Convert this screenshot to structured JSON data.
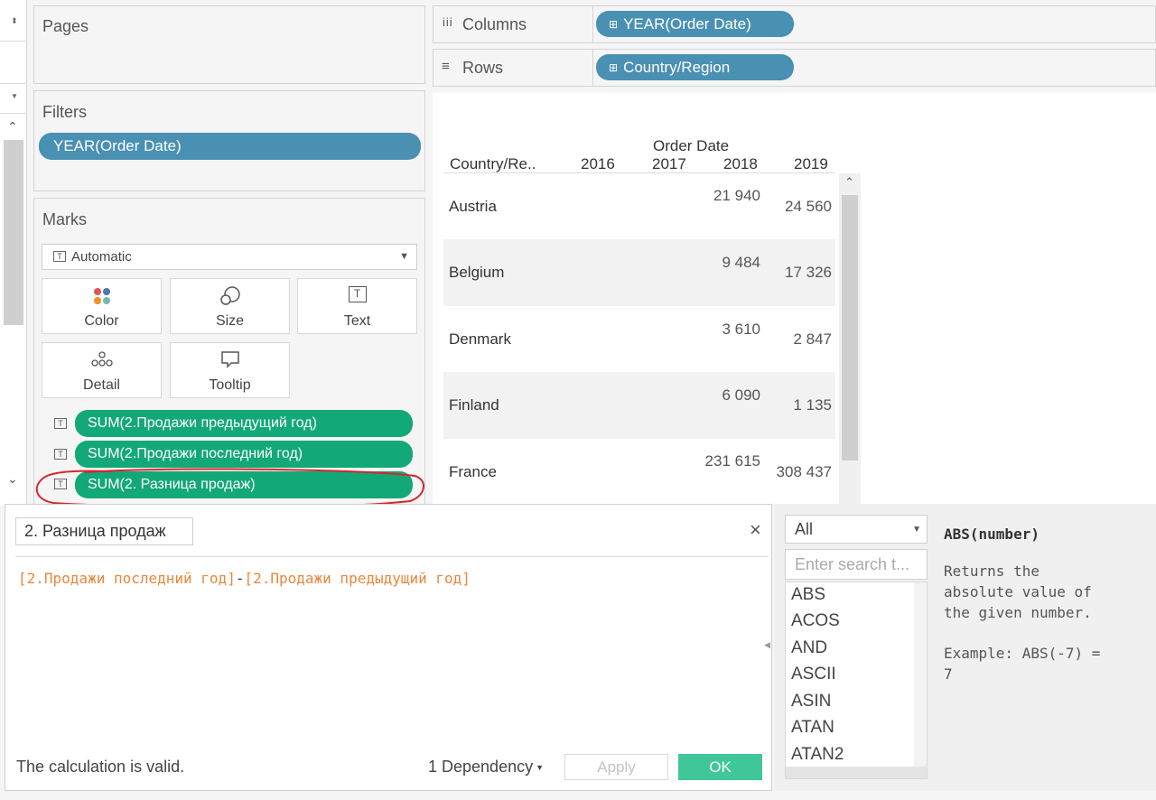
{
  "shelves": {
    "pages_label": "Pages",
    "filters_label": "Filters",
    "filter_pill": "YEAR(Order Date)",
    "columns_label": "Columns",
    "columns_pill": "YEAR(Order Date)",
    "rows_label": "Rows",
    "rows_pill": "Country/Region"
  },
  "marks": {
    "label": "Marks",
    "type_select": "Automatic",
    "buttons": [
      "Color",
      "Size",
      "Text",
      "Detail",
      "Tooltip"
    ],
    "fields": [
      "SUM(2.Продажи предыдущий год)",
      "SUM(2.Продажи последний год)",
      "SUM(2. Разница продаж)"
    ]
  },
  "table": {
    "column_header_title": "Order Date",
    "row_header": "Country/Re..",
    "years": [
      "2016",
      "2017",
      "2018",
      "2019"
    ],
    "rows": [
      {
        "country": "Austria",
        "v2018": "21 940",
        "v2019": "24 560"
      },
      {
        "country": "Belgium",
        "v2018": "9 484",
        "v2019": "17 326"
      },
      {
        "country": "Denmark",
        "v2018": "3 610",
        "v2019": "2 847"
      },
      {
        "country": "Finland",
        "v2018": "6 090",
        "v2019": "1 135"
      },
      {
        "country": "France",
        "v2018": "231 615",
        "v2019": "308 437"
      }
    ]
  },
  "calc_editor": {
    "name": "2. Разница продаж",
    "formula_field1": "[2.Продажи последний год]",
    "formula_op": "-",
    "formula_field2": "[2.Продажи предыдущий год]",
    "status": "The calculation is valid.",
    "dependency": "1 Dependency",
    "apply": "Apply",
    "ok": "OK",
    "close": "×"
  },
  "functions": {
    "category": "All",
    "search_placeholder": "Enter search t...",
    "list": [
      "ABS",
      "ACOS",
      "AND",
      "ASCII",
      "ASIN",
      "ATAN",
      "ATAN2"
    ],
    "help_title": "ABS(number)",
    "help_line1": "Returns the",
    "help_line2": "absolute value of",
    "help_line3": "the given number.",
    "help_example1": "Example: ABS(-7) =",
    "help_example2": "7"
  },
  "colors": {
    "blue_pill": "#4a90b3",
    "green_pill": "#13a877",
    "ok_button": "#3fc79a",
    "formula_text": "#e8883a",
    "annotation": "#d8262b"
  }
}
